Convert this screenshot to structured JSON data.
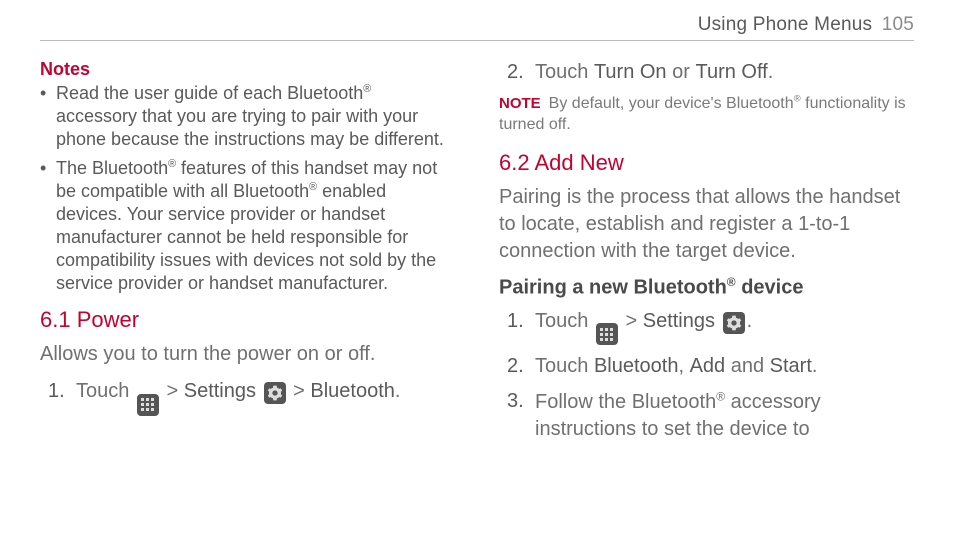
{
  "header": {
    "title": "Using Phone Menus",
    "page_number": "105"
  },
  "left": {
    "notes_heading": "Notes",
    "notes": [
      "Read the user guide of each Bluetooth® accessory that you are trying to pair with your phone because the instructions may be different.",
      "The Bluetooth® features of this handset may not be compatible with all Bluetooth® enabled devices. Your service provider or handset manufacturer cannot be held responsible for compatibility issues with devices not sold by the service provider or handset manufacturer."
    ],
    "section_61_heading": "6.1 Power",
    "section_61_body": "Allows you to turn the power on or off.",
    "step1": {
      "num": "1.",
      "pre": "Touch ",
      "gt1": " > ",
      "settings": "Settings",
      "gt2": " > ",
      "bluetooth": "Bluetooth",
      "dot": "."
    }
  },
  "right": {
    "step2": {
      "num": "2.",
      "pre": "Touch ",
      "turn_on": "Turn On",
      "or": " or ",
      "turn_off": "Turn Off",
      "dot": "."
    },
    "note": {
      "label": "NOTE",
      "text": "By default, your device's Bluetooth® functionality is turned off."
    },
    "section_62_heading": "6.2 Add New",
    "section_62_body": "Pairing is the process that allows the handset to locate, establish and register a 1-to-1 connection with the target device.",
    "pair_heading": "Pairing a new Bluetooth® device",
    "pair_steps": {
      "s1": {
        "num": "1.",
        "pre": "Touch ",
        "gt": " > ",
        "settings": "Settings",
        "dot": "."
      },
      "s2": {
        "num": "2.",
        "pre": "Touch ",
        "bluetooth": "Bluetooth",
        "comma": ", ",
        "add": "Add",
        "and": " and ",
        "start": "Start",
        "dot": "."
      },
      "s3": {
        "num": "3.",
        "text": "Follow the Bluetooth® accessory instructions to set the device to"
      }
    }
  }
}
